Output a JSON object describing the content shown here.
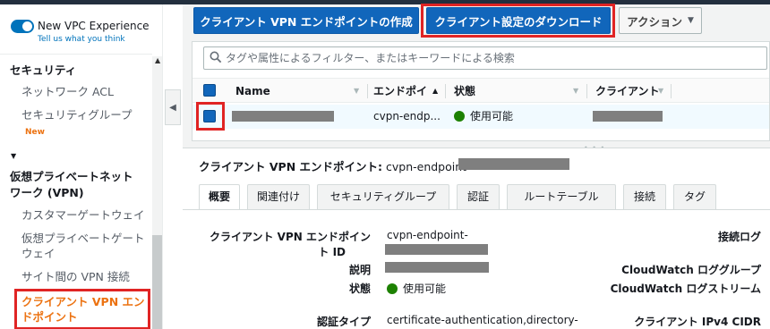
{
  "sidebar": {
    "vpc_experience_title": "New VPC Experience",
    "vpc_experience_link": "Tell us what you think",
    "security_heading": "セキュリティ",
    "network_acl": "ネットワーク ACL",
    "security_groups": "セキュリティグループ",
    "security_groups_badge": "New",
    "vpn_heading_line1": "仮想プライベートネット",
    "vpn_heading_line2": "ワーク (VPN)",
    "customer_gateway": "カスタマーゲートウェイ",
    "vpg_line1": "仮想プライベートゲート",
    "vpg_line2": "ウェイ",
    "site_to_site": "サイト間の VPN 接続",
    "client_vpn_line1": "クライアント VPN エン",
    "client_vpn_line2": "ドポイント"
  },
  "toolbar": {
    "create_label": "クライアント VPN エンドポイントの作成",
    "download_label": "クライアント設定のダウンロード",
    "actions_label": "アクション"
  },
  "filter": {
    "placeholder": "タグや属性によるフィルター、またはキーワードによる検索"
  },
  "table": {
    "columns": [
      "Name",
      "エンドポイ",
      "状態",
      "クライアント"
    ],
    "row": {
      "endpoint_id": "cvpn-endp...",
      "status": "使用可能"
    }
  },
  "detail": {
    "title_label": "クライアント VPN エンドポイント:",
    "title_value": "cvpn-endpoint-",
    "tabs": [
      "概要",
      "関連付け",
      "セキュリティグループ",
      "認証",
      "ルートテーブル",
      "接続",
      "タグ"
    ],
    "fields": {
      "endpoint_id_label_line1": "クライアント VPN エンドポイン",
      "endpoint_id_label_line2": "ト ID",
      "endpoint_id_value": "cvpn-endpoint-",
      "description_label": "説明",
      "status_label": "状態",
      "status_value": "使用可能",
      "auth_type_label": "認証タイプ",
      "auth_type_value": "certificate-authentication,directory-"
    },
    "right_labels": {
      "connection_log": "接続ログ",
      "cloudwatch_log_group": "CloudWatch ロググループ",
      "cloudwatch_log_stream": "CloudWatch ログストリーム",
      "client_ipv4_cidr": "クライアント IPv4 CIDR"
    }
  },
  "colors": {
    "primary": "#1166bb",
    "highlight": "#e02424",
    "active_nav": "#ec7211",
    "available": "#1d8102"
  }
}
